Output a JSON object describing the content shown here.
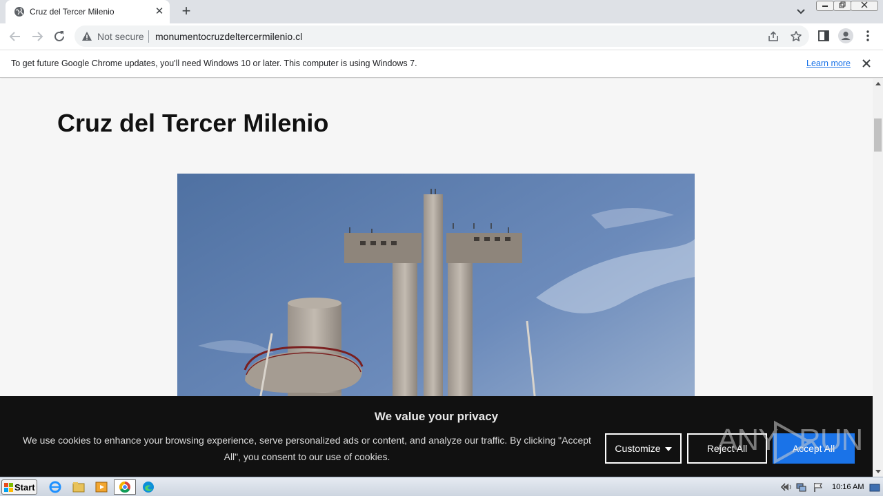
{
  "browser": {
    "tab_title": "Cruz del Tercer Milenio",
    "tab_close": "✕",
    "new_tab": "+",
    "security_label": "Not secure",
    "url": "monumentocruzdeltercermilenio.cl"
  },
  "infobar": {
    "message": "To get future Google Chrome updates, you'll need Windows 10 or later. This computer is using Windows 7.",
    "link": "Learn more"
  },
  "page": {
    "heading": "Cruz del Tercer Milenio"
  },
  "cookie_banner": {
    "heading": "We value your privacy",
    "body": "We use cookies to enhance your browsing experience, serve personalized ads or content, and analyze our traffic. By clicking \"Accept All\", you consent to our use of cookies.",
    "customize_label": "Customize",
    "reject_label": "Reject All",
    "accept_label": "Accept All"
  },
  "watermark": {
    "left": "ANY",
    "right": "RUN"
  },
  "taskbar": {
    "start_label": "Start",
    "clock": "10:16 AM"
  },
  "colors": {
    "accent": "#1a73e8",
    "banner_bg": "#111111",
    "page_bg": "#f6f6f6"
  }
}
